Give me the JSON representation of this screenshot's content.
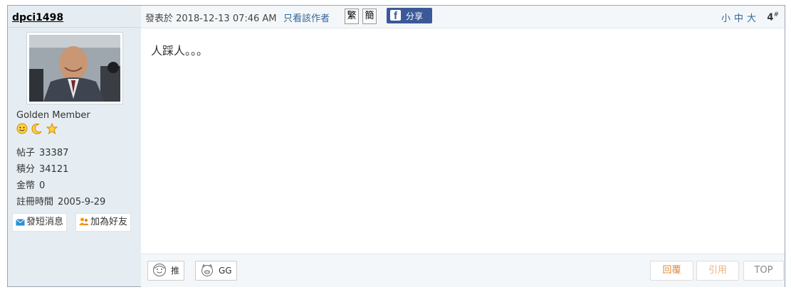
{
  "user": {
    "username": "dpci1498",
    "rank": "Golden Member",
    "rank_icons": [
      "smiley-icon",
      "moon-icon",
      "star-icon"
    ],
    "stats": [
      {
        "label": "帖子",
        "value": "33387"
      },
      {
        "label": "積分",
        "value": "34121"
      },
      {
        "label": "金幣",
        "value": "0"
      },
      {
        "label": "註冊時間",
        "value": "2005-9-29"
      }
    ],
    "send_message_label": "發短消息",
    "add_friend_label": "加為好友"
  },
  "post": {
    "posted_at": "發表於 2018-12-13 07:46 AM",
    "author_only_label": "只看該作者",
    "traditional_label": "繁",
    "simplified_label": "簡",
    "share_label": "分享",
    "font_sizes": [
      "小",
      "中",
      "大"
    ],
    "floor_number": "4",
    "floor_suffix": "#",
    "content": "人踩人。。。",
    "vote_push_label": "推",
    "vote_gg_label": "GG",
    "reply_label": "回覆",
    "quote_label": "引用",
    "top_label": "TOP"
  },
  "colors": {
    "sidebar_bg": "#e5edf2",
    "header_bg": "#f4f7f9",
    "link": "#336699",
    "facebook": "#3b5998",
    "action_orange": "#e08a3c"
  }
}
